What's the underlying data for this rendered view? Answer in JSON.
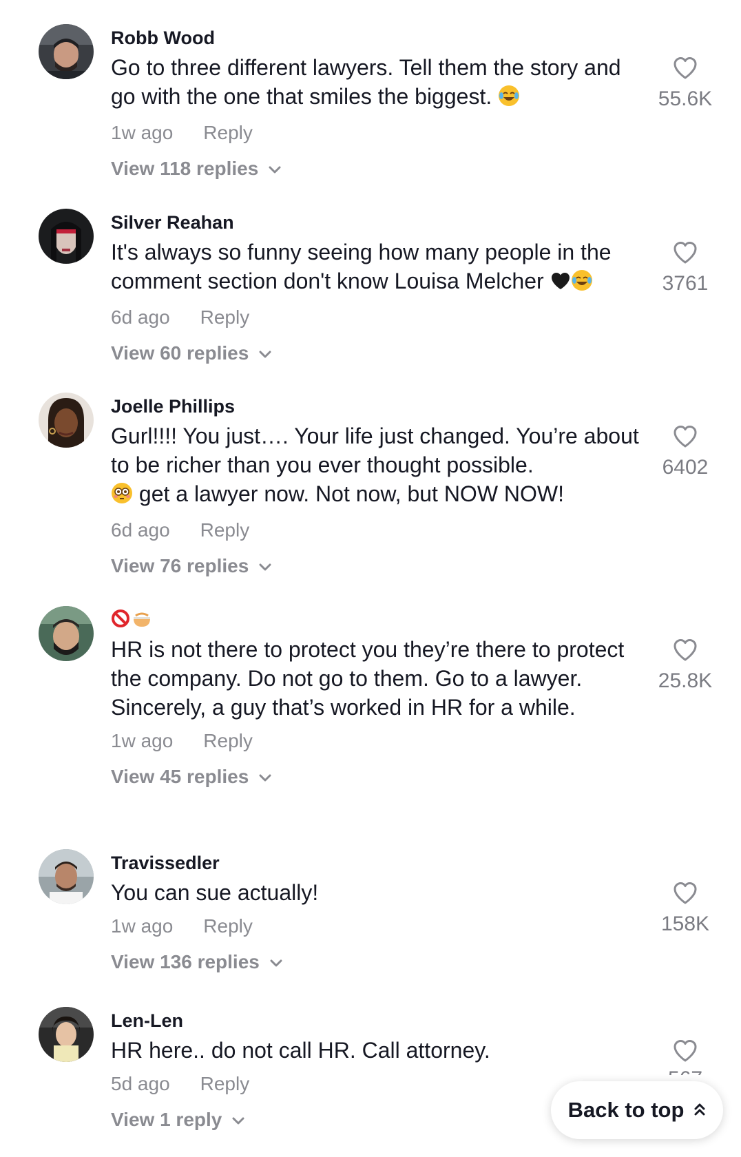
{
  "comments": [
    {
      "username": "Robb Wood",
      "text": "Go to three different lawyers. Tell them the story and go with the one that smiles the biggest.",
      "text_emoji": "laughing-crying",
      "time": "1w ago",
      "reply_label": "Reply",
      "view_replies": "View 118 replies",
      "likes": "55.6K"
    },
    {
      "username": "Silver Reahan",
      "text": "It's always so funny seeing how many people in the comment section don't know Louisa Melcher",
      "text_emoji": "black-heart, laughing-crying",
      "time": "6d ago",
      "reply_label": "Reply",
      "view_replies": "View 60 replies",
      "likes": "3761"
    },
    {
      "username": "Joelle Phillips",
      "text_line1": "Gurl!!!! You just…. Your life just changed. You’re about to be richer than you ever thought possible.",
      "text_line2": "get a lawyer now. Not now, but NOW NOW!",
      "text_emoji": "flushed-face",
      "time": "6d ago",
      "reply_label": "Reply",
      "view_replies": "View 76 replies",
      "likes": "6402"
    },
    {
      "username_emoji": "prohibited, bowl",
      "text": "HR is not there to protect you they’re there to protect the company. Do not go to them. Go to a lawyer. Sincerely, a guy that’s worked in HR for a while.",
      "time": "1w ago",
      "reply_label": "Reply",
      "view_replies": "View 45 replies",
      "likes": "25.8K"
    },
    {
      "username": "Travissedler",
      "text": "You can sue actually!",
      "time": "1w ago",
      "reply_label": "Reply",
      "view_replies": "View 136 replies",
      "likes": "158K"
    },
    {
      "username": "Len-Len",
      "text": "HR here.. do not call HR. Call attorney.",
      "time": "5d ago",
      "reply_label": "Reply",
      "view_replies": "View 1 reply",
      "likes": "567"
    }
  ],
  "back_to_top": "Back to top",
  "colors": {
    "text": "#161823",
    "secondary": "#8a8b91",
    "like_count": "#7a7b82"
  }
}
